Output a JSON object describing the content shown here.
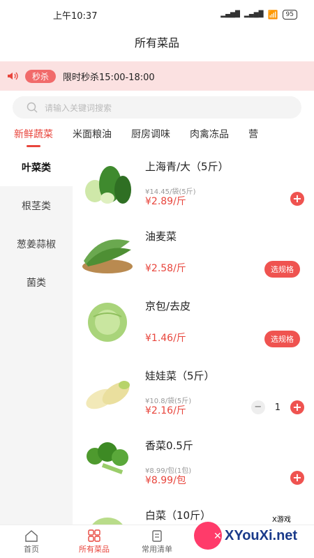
{
  "status": {
    "time": "上午10:37",
    "battery": "95"
  },
  "title": "所有菜品",
  "banner": {
    "badge": "秒杀",
    "text": "限时秒杀15:00-18:00"
  },
  "search": {
    "placeholder": "请输入关键词搜索"
  },
  "categories": [
    "新鲜蔬菜",
    "米面粮油",
    "厨房调味",
    "肉禽冻品",
    "营"
  ],
  "subcategories": [
    "叶菜类",
    "根茎类",
    "葱姜蒜椒",
    "菌类"
  ],
  "products": [
    {
      "name": "上海青/大（5斤）",
      "orig": "¥14.45/袋(5斤)",
      "price": "¥2.89/斤"
    },
    {
      "name": "油麦菜",
      "price": "¥2.58/斤",
      "action": "选规格"
    },
    {
      "name": "京包/去皮",
      "price": "¥1.46/斤",
      "action": "选规格"
    },
    {
      "name": "娃娃菜（5斤）",
      "orig": "¥10.8/袋(5斤)",
      "price": "¥2.16/斤",
      "qty": "1"
    },
    {
      "name": "香菜0.5斤",
      "orig": "¥8.99/包(1包)",
      "price": "¥8.99/包"
    },
    {
      "name": "白菜（10斤）"
    }
  ],
  "tabs": [
    "首页",
    "所有菜品",
    "常用清单"
  ],
  "watermark": {
    "brand": "XYouXi.net",
    "tag": "X游戏"
  },
  "colors": {
    "accent": "#e8453c",
    "banner_bg": "#fbe1e1"
  }
}
